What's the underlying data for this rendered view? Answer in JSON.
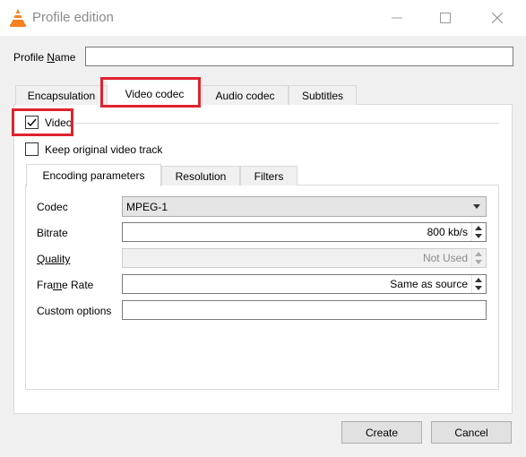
{
  "window": {
    "title": "Profile edition",
    "controls": [
      "minimize-icon",
      "maximize-icon",
      "close-icon"
    ]
  },
  "profile_name": {
    "label_prefix": "Profile ",
    "label_key": "N",
    "label_suffix": "ame",
    "value": ""
  },
  "tabs": [
    {
      "label": "Encapsulation",
      "active": false
    },
    {
      "label": "Video codec",
      "active": true,
      "highlighted": true
    },
    {
      "label": "Audio codec",
      "active": false
    },
    {
      "label": "Subtitles",
      "active": false
    }
  ],
  "video": {
    "enabled_label": "Video",
    "enabled_checked": true,
    "enabled_highlighted": true,
    "keep_original_label": "Keep original video track",
    "keep_original_checked": false
  },
  "subtabs": [
    {
      "label": "Encoding parameters",
      "active": true
    },
    {
      "label": "Resolution",
      "active": false
    },
    {
      "label": "Filters",
      "active": false
    }
  ],
  "encoding": {
    "codec": {
      "label": "Codec",
      "value": "MPEG-1"
    },
    "bitrate": {
      "label": "Bitrate",
      "value": "800 kb/s"
    },
    "quality": {
      "label": "Quality",
      "value": "Not Used",
      "disabled": true
    },
    "frame_rate": {
      "label_prefix": "Fra",
      "label_key": "m",
      "label_suffix": "e Rate",
      "value": "Same as source"
    },
    "custom_options": {
      "label": "Custom options",
      "value": ""
    }
  },
  "buttons": {
    "create": "Create",
    "cancel": "Cancel"
  },
  "colors": {
    "highlight": "#e0222e",
    "vlc_orange": "#f58220"
  }
}
